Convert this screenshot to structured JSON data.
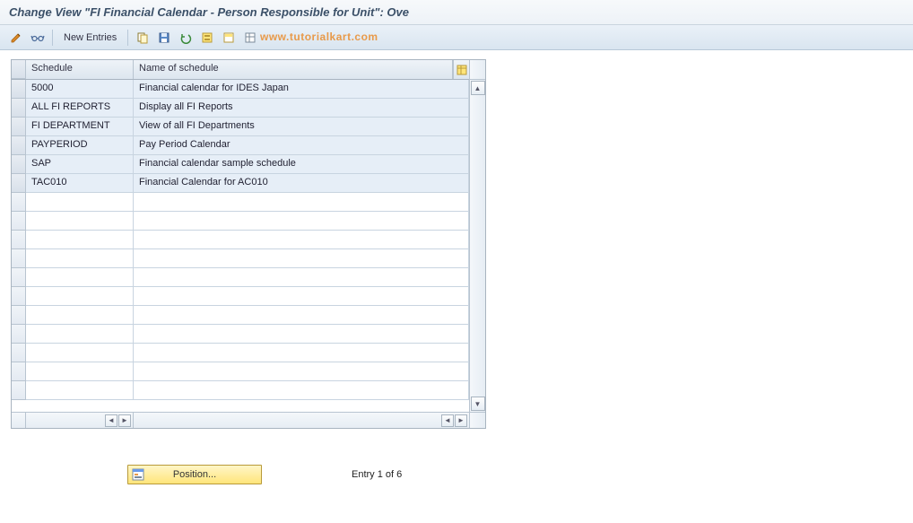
{
  "title": "Change View \"FI Financial Calendar - Person Responsible for Unit\": Ove",
  "watermark": "www.tutorialkart.com",
  "toolbar": {
    "new_entries_label": "New Entries"
  },
  "table": {
    "columns": {
      "schedule": "Schedule",
      "name": "Name of schedule"
    },
    "rows": [
      {
        "schedule": "5000",
        "name": "Financial calendar for IDES Japan"
      },
      {
        "schedule": "ALL FI REPORTS",
        "name": "Display all FI Reports"
      },
      {
        "schedule": "FI DEPARTMENT",
        "name": "View of all FI Departments"
      },
      {
        "schedule": "PAYPERIOD",
        "name": "Pay Period Calendar"
      },
      {
        "schedule": "SAP",
        "name": "Financial calendar sample schedule"
      },
      {
        "schedule": "TAC010",
        "name": "Financial Calendar for AC010"
      }
    ],
    "empty_rows": 11
  },
  "footer": {
    "position_label": "Position...",
    "entry_text": "Entry 1 of 6"
  },
  "icons": {
    "change": "change-display-icon",
    "glasses": "glasses-icon",
    "copy": "copy-icon",
    "save": "save-icon",
    "undo": "undo-icon",
    "select_all": "select-all-icon",
    "deselect_all": "deselect-all-icon",
    "table_settings": "table-settings-icon",
    "config_col": "configure-columns-icon",
    "position": "position-icon"
  }
}
